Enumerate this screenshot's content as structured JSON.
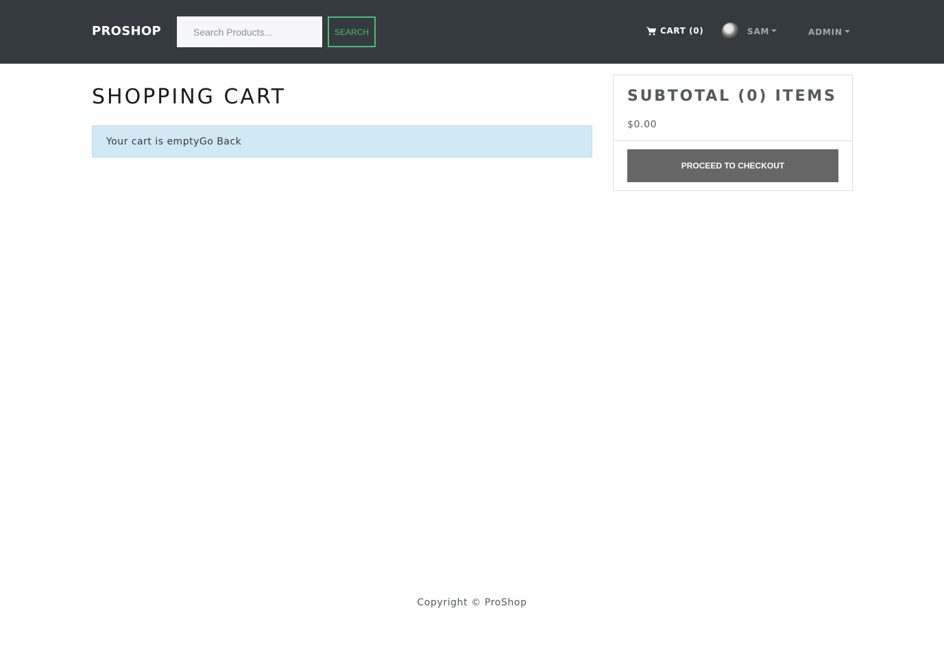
{
  "header": {
    "brand": "PROSHOP",
    "search": {
      "placeholder": "Search Products...",
      "value": "",
      "button_label": "SEARCH"
    },
    "cart": {
      "label": "CART (0)",
      "icon": "shopping-cart-icon"
    },
    "user": {
      "name": "SAM",
      "avatar": "user-avatar"
    },
    "admin": {
      "label": "ADMIN"
    }
  },
  "main": {
    "title": "SHOPPING CART",
    "empty_message": "Your cart is empty",
    "go_back_label": "Go Back"
  },
  "summary": {
    "title": "SUBTOTAL (0) ITEMS",
    "amount": "$0.00",
    "checkout_label": "PROCEED TO CHECKOUT"
  },
  "footer": {
    "copyright": "Copyright © ProShop"
  },
  "colors": {
    "navbar": "#343a40",
    "search_accent": "#4bbf73",
    "alert_bg": "#d1e9f3",
    "checkout_button": "#666666"
  }
}
